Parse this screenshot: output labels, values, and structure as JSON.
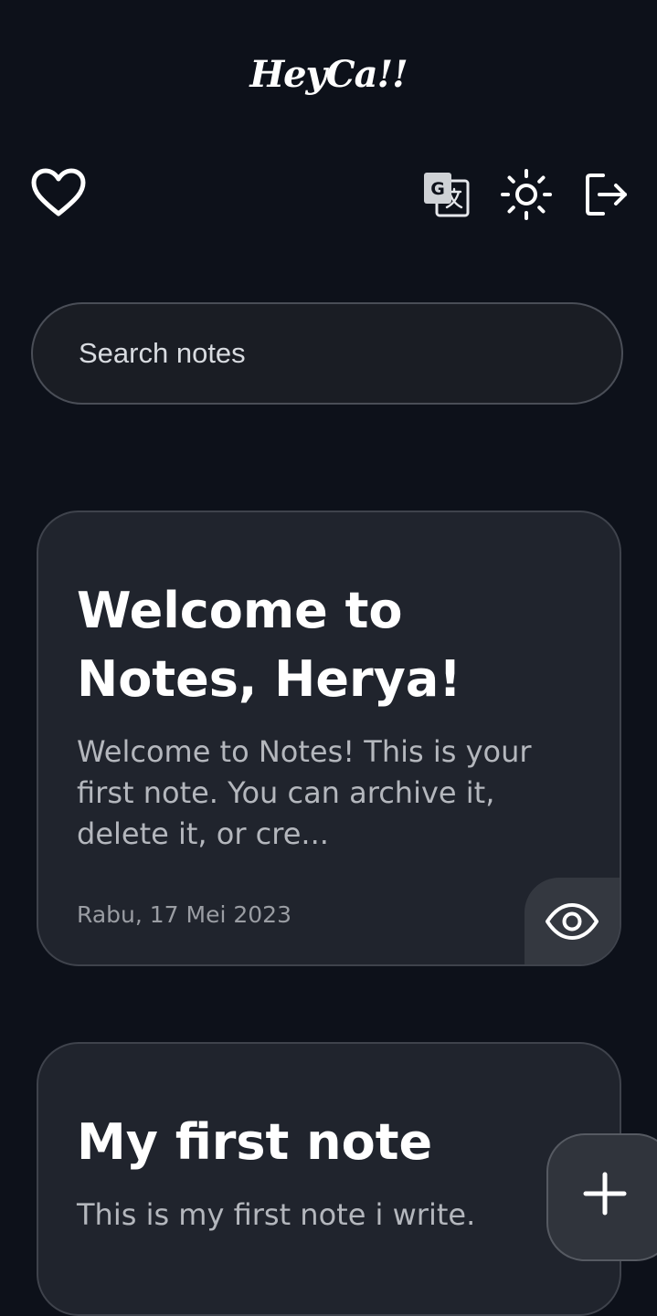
{
  "app": {
    "title": "HeyCa!!"
  },
  "toolbar": {
    "favorites_icon": "heart-icon",
    "translate_icon": "translate-icon",
    "theme_icon": "sun-icon",
    "logout_icon": "logout-icon"
  },
  "search": {
    "placeholder": "Search notes",
    "value": ""
  },
  "notes": [
    {
      "title": "Welcome to Notes, Herya!",
      "body": "Welcome to Notes! This is your first note. You can archive it, delete it, or cre...",
      "date": "Rabu, 17 Mei 2023",
      "action_icon": "eye-icon"
    },
    {
      "title": "My first note",
      "body": "This is my first note i write."
    }
  ],
  "fab": {
    "icon": "plus-icon"
  },
  "colors": {
    "background": "#0d111a",
    "card": "#20242d",
    "card_border": "#3f434c",
    "text_primary": "#ffffff",
    "text_secondary": "#b4b7bd"
  }
}
